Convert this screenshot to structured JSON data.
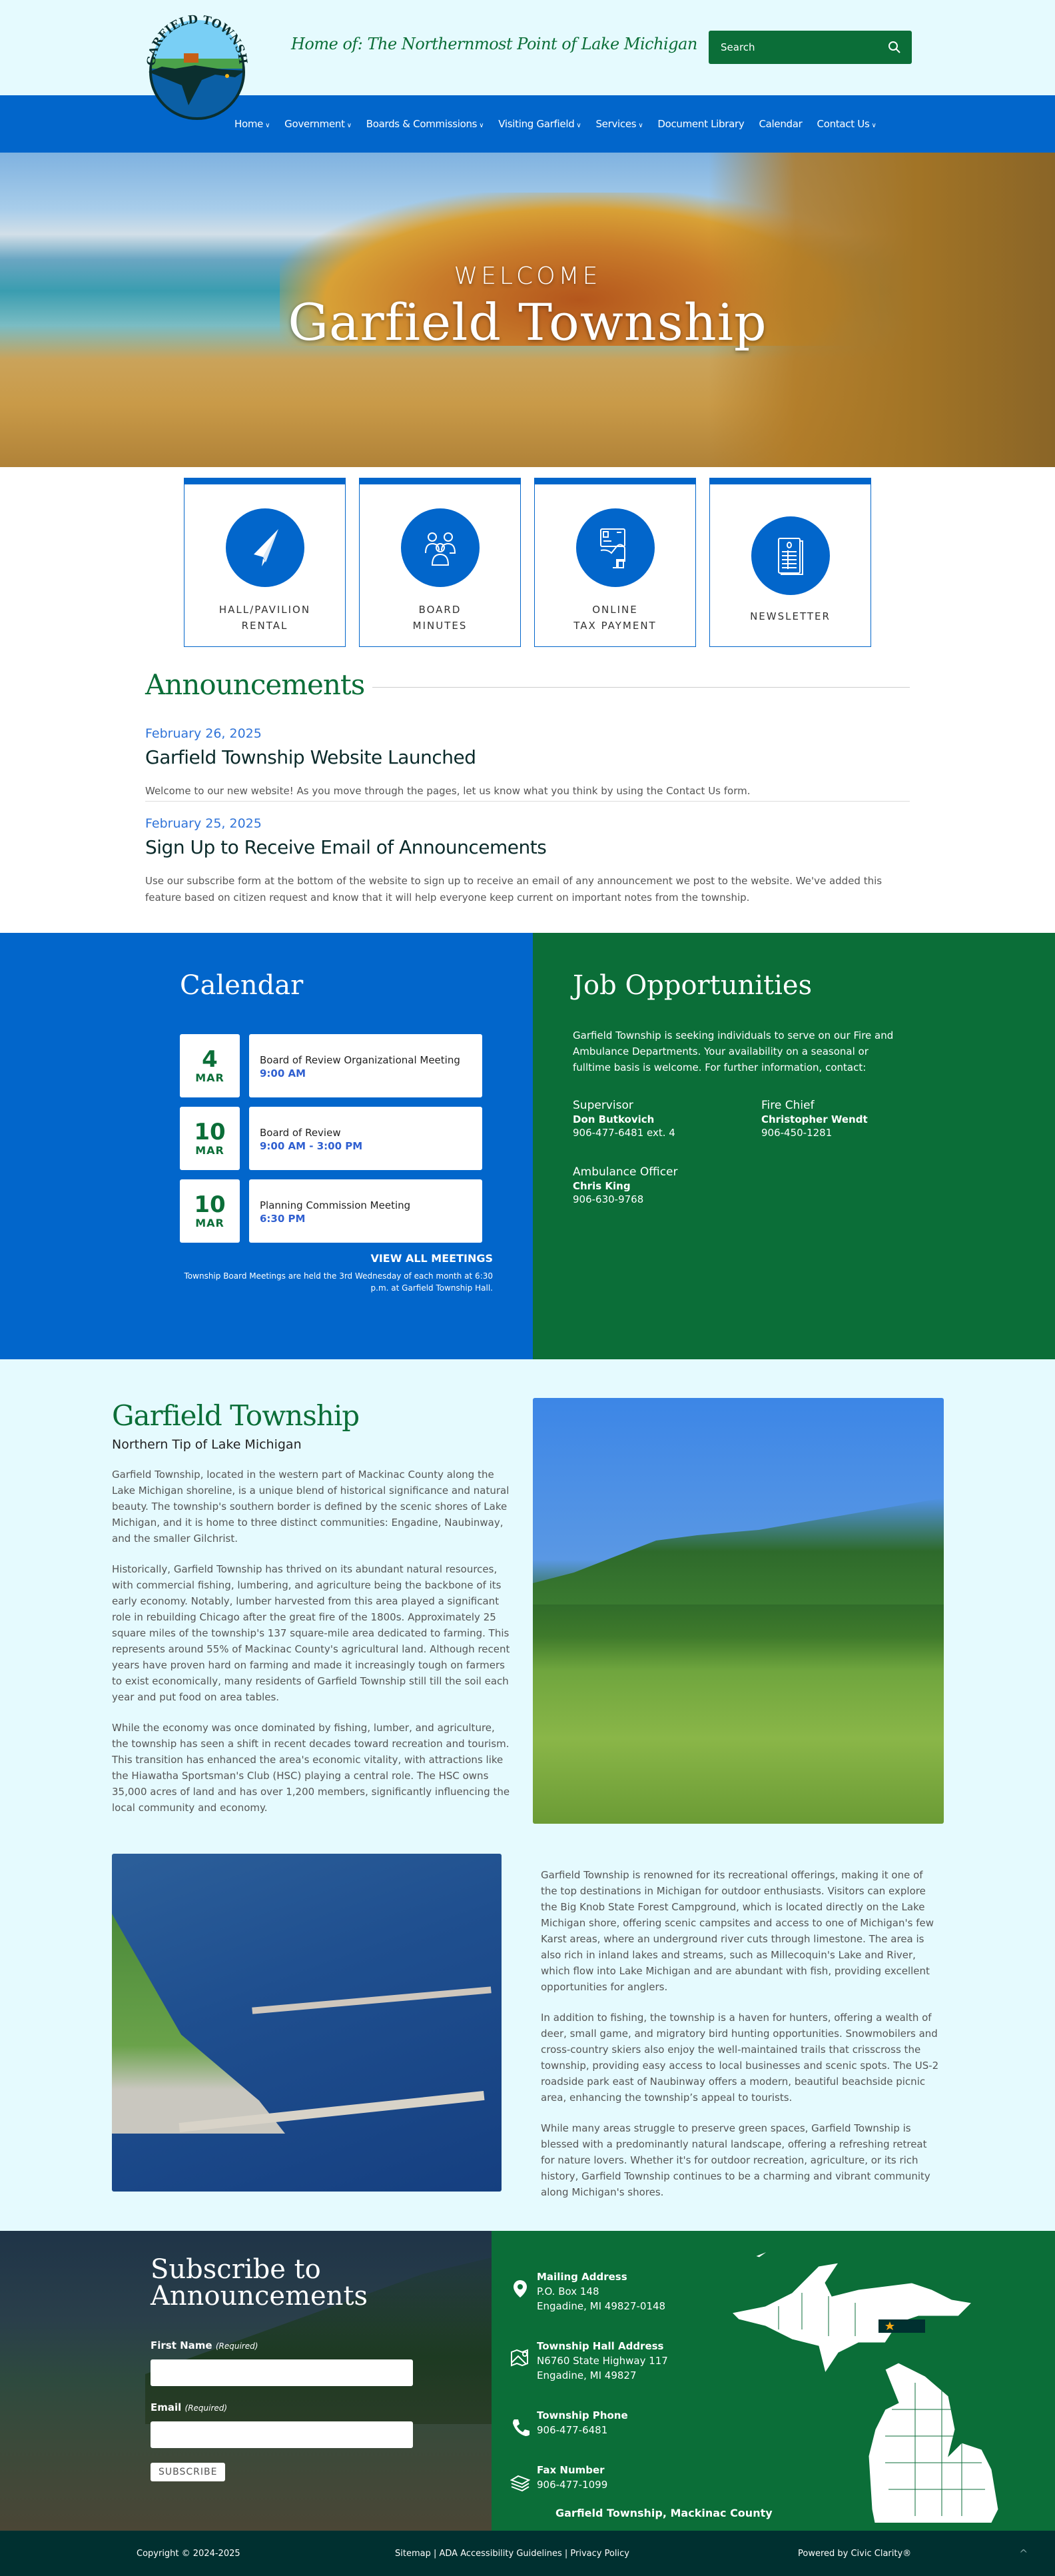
{
  "header": {
    "logo_alt": "Garfield Township seal",
    "tagline": "Home of: The Northernmost Point of Lake Michigan",
    "search_placeholder": "Search"
  },
  "nav": [
    {
      "label": "Home",
      "dropdown": true
    },
    {
      "label": "Government",
      "dropdown": true
    },
    {
      "label": "Boards & Commissions",
      "dropdown": true
    },
    {
      "label": "Visiting Garfield",
      "dropdown": true
    },
    {
      "label": "Services",
      "dropdown": true
    },
    {
      "label": "Document Library",
      "dropdown": false
    },
    {
      "label": "Calendar",
      "dropdown": false
    },
    {
      "label": "Contact Us",
      "dropdown": true
    }
  ],
  "hero": {
    "welcome": "WELCOME",
    "title": "Garfield Township"
  },
  "quick_links": [
    {
      "label": "HALL/PAVILION\nRENTAL",
      "icon": "paper-plane-icon"
    },
    {
      "label": "BOARD\nMINUTES",
      "icon": "people-icon"
    },
    {
      "label": "ONLINE\nTAX PAYMENT",
      "icon": "credit-card-hand-icon"
    },
    {
      "label": "NEWSLETTER",
      "icon": "newsletter-icon"
    }
  ],
  "announcements": {
    "heading": "Announcements",
    "posts": [
      {
        "date": "February 26, 2025",
        "title": "Garfield Township Website Launched",
        "body": "Welcome to our new website!  As you move through the pages, let us know what you think by using the Contact Us form."
      },
      {
        "date": "February 25, 2025",
        "title": "Sign Up to Receive Email of Announcements",
        "body": "Use our subscribe form at the bottom of the website to sign up to receive an email of any announcement we post to the website.  We've added this feature based on citizen request and know that it will help everyone keep current on important notes from the township."
      }
    ]
  },
  "calendar": {
    "heading": "Calendar",
    "events": [
      {
        "day": "4",
        "month": "MAR",
        "title": "Board of Review Organizational Meeting",
        "time": "9:00 AM"
      },
      {
        "day": "10",
        "month": "MAR",
        "title": "Board of Review",
        "time": "9:00 AM - 3:00 PM"
      },
      {
        "day": "10",
        "month": "MAR",
        "title": "Planning Commission Meeting",
        "time": "6:30 PM"
      }
    ],
    "view_all": "VIEW ALL MEETINGS",
    "note": "Township Board Meetings are held the 3rd Wednesday of each month at 6:30 p.m. at Garfield Township Hall."
  },
  "jobs": {
    "heading": "Job Opportunities",
    "intro": "Garfield Township is seeking individuals to serve on our Fire and Ambulance Departments.  Your availability on a seasonal or fulltime basis is welcome.  For further information, contact:",
    "contacts": [
      {
        "role": "Supervisor",
        "name": "Don Butkovich",
        "phone": "906-477-6481 ext. 4"
      },
      {
        "role": "Fire Chief",
        "name": "Christopher Wendt",
        "phone": "906-450-1281"
      },
      {
        "role": "Ambulance Officer",
        "name": "Chris King",
        "phone": "906-630-9768"
      }
    ]
  },
  "about": {
    "heading": "Garfield Township",
    "subheading": "Northern Tip of Lake Michigan",
    "left_paragraphs": [
      "Garfield Township, located in the western part of Mackinac County along the Lake Michigan shoreline, is a unique blend of historical significance and natural beauty. The township's southern border is defined by the scenic shores of Lake Michigan, and it is home to three distinct communities: Engadine, Naubinway, and the smaller Gilchrist.",
      "Historically, Garfield Township has thrived on its abundant natural resources, with commercial fishing, lumbering, and agriculture being the backbone of its early economy. Notably, lumber harvested from this area played a significant role in rebuilding Chicago after the great fire of the 1800s.  Approximately 25 square miles of the township's 137 square-mile area dedicated to farming. This represents around 55% of Mackinac County's agricultural land. Although recent years have proven hard on farming and made it increasingly tough on farmers to exist economically, many residents of Garfield Township still till the soil each year and put food on area tables.",
      "While the economy was once dominated by fishing, lumber, and agriculture, the township has seen a shift in recent decades toward recreation and tourism. This transition has enhanced the area's economic vitality, with attractions like the Hiawatha Sportsman's Club (HSC) playing a central role. The HSC owns 35,000 acres of land and has over 1,200 members, significantly influencing the local community and economy."
    ],
    "right_paragraphs": [
      "Garfield Township is renowned for its recreational offerings, making it one of the top destinations in Michigan for outdoor enthusiasts. Visitors can explore the Big Knob State Forest Campground, which is located directly on the Lake Michigan shore, offering scenic campsites and access to one of Michigan's few Karst areas, where an underground river cuts through limestone. The area is also rich in inland lakes and streams, such as Millecoquin's Lake and River, which flow into Lake Michigan and are abundant with fish, providing excellent opportunities for anglers.",
      "In addition to fishing, the township is a haven for hunters, offering a wealth of deer, small game, and migratory bird hunting opportunities. Snowmobilers and cross-country skiers also enjoy the well-maintained trails that crisscross the township, providing easy access to local businesses and scenic spots. The US-2 roadside park east of Naubinway offers a modern, beautiful beachside picnic area, enhancing the township’s appeal to tourists.",
      "While many areas struggle to preserve green spaces, Garfield Township is blessed with a predominantly natural landscape, offering a refreshing retreat for nature lovers. Whether it's for outdoor recreation, agriculture, or its rich history, Garfield Township continues to be a charming and vibrant community along Michigan's shores."
    ]
  },
  "subscribe": {
    "heading": "Subscribe to Announcements",
    "first_name_label": "First Name",
    "email_label": "Email",
    "required_label": "(Required)",
    "first_name_value": "",
    "email_value": "",
    "button": "SUBSCRIBE"
  },
  "contact_info": {
    "items": [
      {
        "icon": "map-pin-icon",
        "title": "Mailing Address",
        "lines": [
          "P.O. Box 148",
          "Engadine, MI 49827-0148"
        ]
      },
      {
        "icon": "map-icon",
        "title": "Township Hall Address",
        "lines": [
          "N6760 State Highway 117",
          "Engadine, MI 49827"
        ]
      },
      {
        "icon": "phone-icon",
        "title": "Township Phone",
        "lines": [
          "906-477-6481"
        ]
      },
      {
        "icon": "fax-icon",
        "title": "Fax Number",
        "lines": [
          "906-477-1099"
        ]
      }
    ],
    "county": "Garfield Township, Mackinac County"
  },
  "footer": {
    "copyright": "Copyright © 2024-2025",
    "links": [
      "Sitemap",
      "ADA Accessibility Guidelines",
      "Privacy Policy"
    ],
    "separator": " | ",
    "powered_by": "Powered by Civic Clarity®",
    "back_to_top": "^"
  },
  "colors": {
    "primary_blue": "#0266cb",
    "primary_green": "#0b6e38",
    "dark_teal": "#003030",
    "page_bg": "#e5fafe",
    "date_blue": "#2f73d8"
  }
}
